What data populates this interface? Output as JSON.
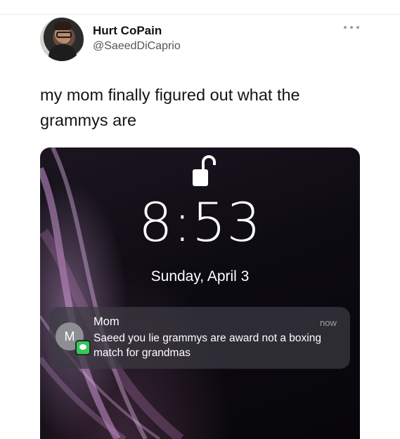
{
  "tweet": {
    "author_name": "Hurt CoPain",
    "author_handle": "@SaeedDiCaprio",
    "text": "my mom finally figured out what the grammys are"
  },
  "icons": {
    "more": "more-options-icon",
    "lock": "unlocked-padlock-icon",
    "messages": "messages-app-icon"
  },
  "lockscreen": {
    "time": "8:53",
    "date": "Sunday, April 3",
    "notification": {
      "avatar_initial": "M",
      "sender": "Mom",
      "timestamp": "now",
      "message": "Saeed you lie grammys are award not a boxing match for grandmas"
    }
  },
  "colors": {
    "notification_bg": "#3c3a42",
    "messages_green": "#34c759",
    "handle_gray": "#555555"
  }
}
